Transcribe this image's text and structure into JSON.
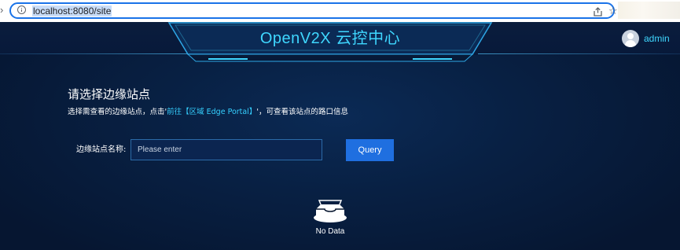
{
  "browser": {
    "url": "localhost:8080/site"
  },
  "header": {
    "title": "OpenV2X 云控中心",
    "username": "admin"
  },
  "main": {
    "heading": "请选择边缘站点",
    "hint_prefix": "选择需查看的边缘站点，点击'",
    "hint_link": "前往【区域 Edge Portal】",
    "hint_suffix": "'，可查看该站点的路口信息",
    "search": {
      "label": "边缘站点名称:",
      "placeholder": "Please enter",
      "value": ""
    },
    "query_button": "Query",
    "empty_text": "No Data"
  },
  "colors": {
    "accent": "#3fd7ff",
    "primary_button": "#1f6fe0",
    "background": "#061631"
  }
}
